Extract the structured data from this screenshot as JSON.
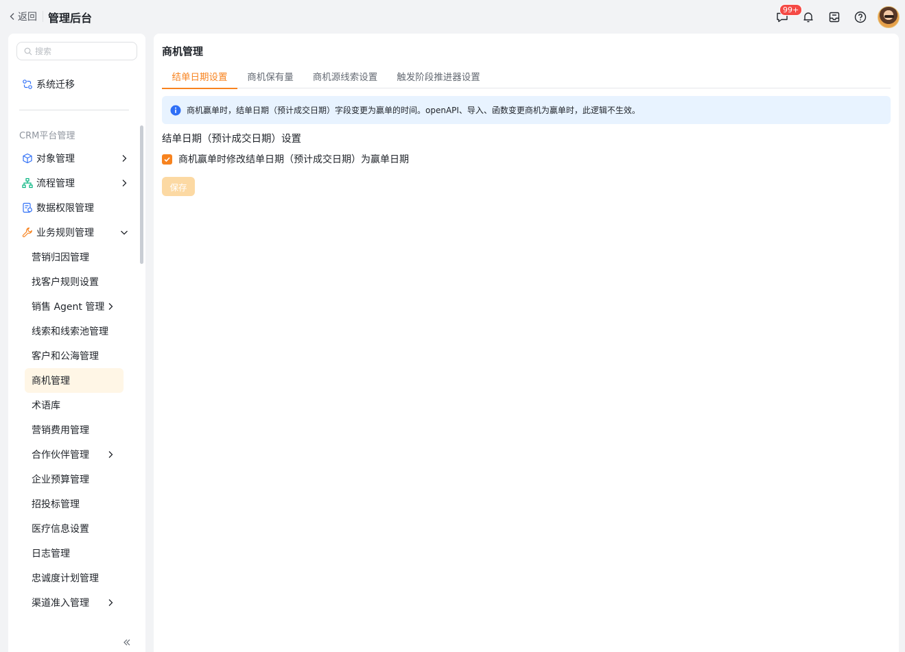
{
  "topbar": {
    "back_label": "返回",
    "app_title": "管理后台",
    "message_badge": "99+"
  },
  "sidebar": {
    "search_placeholder": "搜索",
    "top_item": "系统迁移",
    "section_label": "CRM平台管理",
    "items": [
      {
        "label": "对象管理",
        "expandable": true,
        "icon": "cube-icon"
      },
      {
        "label": "流程管理",
        "expandable": true,
        "icon": "flow-icon"
      },
      {
        "label": "数据权限管理",
        "expandable": false,
        "icon": "data-permission-icon"
      },
      {
        "label": "业务规则管理",
        "expandable": true,
        "expanded": true,
        "icon": "wrench-icon"
      }
    ],
    "sub_items": [
      {
        "label": "营销归因管理"
      },
      {
        "label": "找客户规则设置"
      },
      {
        "label": "销售 Agent 管理",
        "expandable": true
      },
      {
        "label": "线索和线索池管理"
      },
      {
        "label": "客户和公海管理"
      },
      {
        "label": "商机管理",
        "active": true
      },
      {
        "label": "术语库"
      },
      {
        "label": "营销费用管理"
      },
      {
        "label": "合作伙伴管理",
        "expandable": true
      },
      {
        "label": "企业预算管理"
      },
      {
        "label": "招投标管理"
      },
      {
        "label": "医疗信息设置"
      },
      {
        "label": "日志管理"
      },
      {
        "label": "忠诚度计划管理"
      },
      {
        "label": "渠道准入管理",
        "expandable": true
      }
    ]
  },
  "main": {
    "title": "商机管理",
    "tabs": [
      {
        "label": "结单日期设置",
        "active": true
      },
      {
        "label": "商机保有量"
      },
      {
        "label": "商机源线索设置"
      },
      {
        "label": "触发阶段推进器设置"
      }
    ],
    "notice": "商机赢单时，结单日期（预计成交日期）字段变更为赢单的时间。openAPI、导入、函数变更商机为赢单时，此逻辑不生效。",
    "section_title": "结单日期（预计成交日期）设置",
    "checkbox_label": "商机赢单时修改结单日期（预计成交日期）为赢单日期",
    "checkbox_checked": true,
    "save_label": "保存"
  },
  "colors": {
    "accent": "#f7831f",
    "active_bg": "#fff6e6",
    "notice_bg": "#e8f3ff",
    "info_icon": "#2f6ff6",
    "badge": "#f54a45"
  }
}
